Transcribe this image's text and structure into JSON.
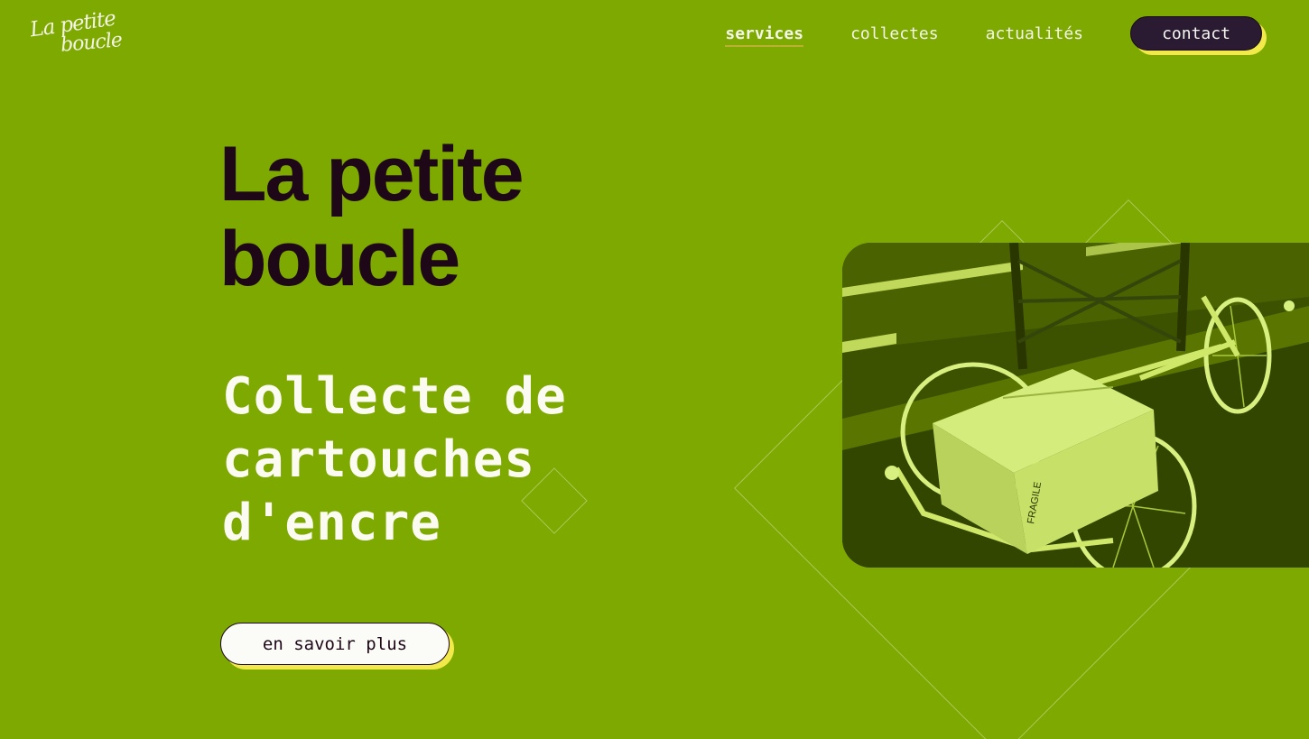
{
  "logo": {
    "line1": "La petite",
    "line2": "boucle"
  },
  "nav": {
    "links": [
      {
        "label": "services",
        "active": true
      },
      {
        "label": "collectes",
        "active": false
      },
      {
        "label": "actualités",
        "active": false
      }
    ],
    "contact_label": "contact"
  },
  "hero": {
    "title_lines": [
      "La petite",
      "boucle"
    ],
    "subtitle_lines": [
      "Collecte de",
      "cartouches",
      "d'encre"
    ],
    "cta_label": "en savoir plus",
    "photo_box_label": "FRAGILE"
  },
  "colors": {
    "background": "#7ea900",
    "title": "#1e0717",
    "button_dark": "#2a1a32",
    "button_accent_shadow": "#f2e94a",
    "button_light": "#fbfbf7"
  },
  "icons": {
    "photo": "cargo-tricycle-photo"
  }
}
